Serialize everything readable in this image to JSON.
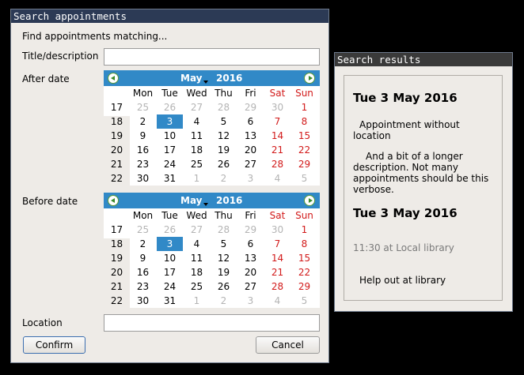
{
  "search_window": {
    "title": "Search appointments",
    "heading": "Find appointments matching...",
    "title_label": "Title/description",
    "title_value": "",
    "after_label": "After date",
    "before_label": "Before date",
    "location_label": "Location",
    "location_value": "",
    "confirm_label": "Confirm",
    "cancel_label": "Cancel"
  },
  "calendars": [
    {
      "month": "May",
      "year": "2016",
      "weekdays": [
        "Mon",
        "Tue",
        "Wed",
        "Thu",
        "Fri",
        "Sat",
        "Sun"
      ],
      "weeks": [
        "17",
        "18",
        "19",
        "20",
        "21",
        "22"
      ],
      "days": [
        [
          "25",
          "26",
          "27",
          "28",
          "29",
          "30",
          "1"
        ],
        [
          "2",
          "3",
          "4",
          "5",
          "6",
          "7",
          "8"
        ],
        [
          "9",
          "10",
          "11",
          "12",
          "13",
          "14",
          "15"
        ],
        [
          "16",
          "17",
          "18",
          "19",
          "20",
          "21",
          "22"
        ],
        [
          "23",
          "24",
          "25",
          "26",
          "27",
          "28",
          "29"
        ],
        [
          "30",
          "31",
          "1",
          "2",
          "3",
          "4",
          "5"
        ]
      ],
      "other_month": [
        [
          1,
          1,
          1,
          1,
          1,
          1,
          0
        ],
        [
          0,
          0,
          0,
          0,
          0,
          0,
          0
        ],
        [
          0,
          0,
          0,
          0,
          0,
          0,
          0
        ],
        [
          0,
          0,
          0,
          0,
          0,
          0,
          0
        ],
        [
          0,
          0,
          0,
          0,
          0,
          0,
          0
        ],
        [
          0,
          0,
          1,
          1,
          1,
          1,
          1
        ]
      ],
      "selected": [
        1,
        1
      ]
    },
    {
      "month": "May",
      "year": "2016",
      "weekdays": [
        "Mon",
        "Tue",
        "Wed",
        "Thu",
        "Fri",
        "Sat",
        "Sun"
      ],
      "weeks": [
        "17",
        "18",
        "19",
        "20",
        "21",
        "22"
      ],
      "days": [
        [
          "25",
          "26",
          "27",
          "28",
          "29",
          "30",
          "1"
        ],
        [
          "2",
          "3",
          "4",
          "5",
          "6",
          "7",
          "8"
        ],
        [
          "9",
          "10",
          "11",
          "12",
          "13",
          "14",
          "15"
        ],
        [
          "16",
          "17",
          "18",
          "19",
          "20",
          "21",
          "22"
        ],
        [
          "23",
          "24",
          "25",
          "26",
          "27",
          "28",
          "29"
        ],
        [
          "30",
          "31",
          "1",
          "2",
          "3",
          "4",
          "5"
        ]
      ],
      "other_month": [
        [
          1,
          1,
          1,
          1,
          1,
          1,
          0
        ],
        [
          0,
          0,
          0,
          0,
          0,
          0,
          0
        ],
        [
          0,
          0,
          0,
          0,
          0,
          0,
          0
        ],
        [
          0,
          0,
          0,
          0,
          0,
          0,
          0
        ],
        [
          0,
          0,
          0,
          0,
          0,
          0,
          0
        ],
        [
          0,
          0,
          1,
          1,
          1,
          1,
          1
        ]
      ],
      "selected": [
        1,
        1
      ]
    }
  ],
  "results_window": {
    "title": "Search results",
    "results": [
      {
        "date": "Tue 3 May 2016",
        "title_line1": "Appointment without",
        "title_line2": "location",
        "desc_line1": "And a bit of a longer",
        "desc_line2": "description. Not many",
        "desc_line3": "appointments should be this",
        "desc_line4": "verbose."
      },
      {
        "date": "Tue 3 May 2016",
        "time_location": "11:30 at Local library",
        "title": "Help out at library"
      }
    ]
  },
  "colors": {
    "accent": "#3189c7",
    "weekend": "#d21a1a",
    "window_bg": "#eeebe7",
    "titlebar": "#2c3a55"
  }
}
